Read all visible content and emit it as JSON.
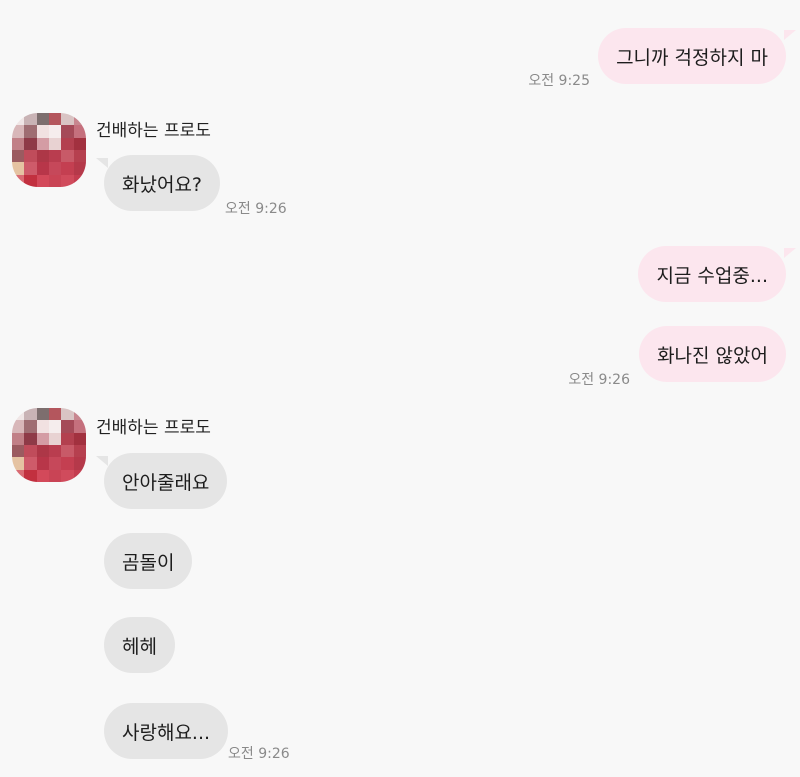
{
  "contact": {
    "name": "건배하는 프로도"
  },
  "messages": {
    "out1": {
      "text": "그니까 걱정하지 마",
      "time": "오전 9:25"
    },
    "in1": {
      "text": "화났어요?",
      "time": "오전 9:26"
    },
    "out2": {
      "text": "지금 수업중..."
    },
    "out3": {
      "text": "화나진 않았어",
      "time": "오전 9:26"
    },
    "in2": {
      "text": "안아줄래요"
    },
    "in3": {
      "text": "곰돌이"
    },
    "in4": {
      "text": "헤헤"
    },
    "in5": {
      "text": "사랑해요...",
      "time": "오전 9:26"
    }
  },
  "colors": {
    "outgoing_bubble": "#fce6ee",
    "incoming_bubble": "#e5e5e5",
    "background": "#f8f8f8",
    "timestamp": "#8a8a8a"
  },
  "avatar_icon": "pixelated-profile-avatar"
}
